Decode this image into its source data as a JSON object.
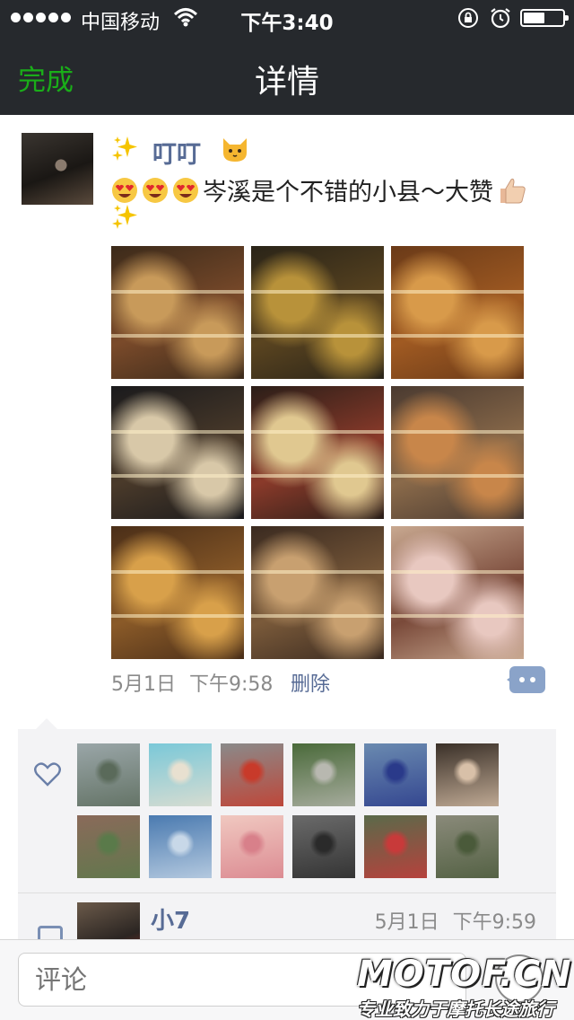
{
  "status_bar": {
    "carrier": "中国移动",
    "time": "下午3:40",
    "signal_dots": 5,
    "battery_level": 0.55,
    "icons": [
      "signal-dots-icon",
      "wifi-icon",
      "rotation-lock-icon",
      "alarm-icon",
      "battery-icon"
    ]
  },
  "nav": {
    "done_label": "完成",
    "title": "详情"
  },
  "post": {
    "author": "叮叮",
    "text": "岑溪是个不错的小县～大赞",
    "emoji_before_text": [
      "heart-eyes-emoji",
      "heart-eyes-emoji",
      "heart-eyes-emoji"
    ],
    "emoji_after_text": [
      "thumbs-up-emoji",
      "sparkles-emoji"
    ],
    "author_decorations": [
      "sparkles-emoji",
      "cat-emoji"
    ],
    "date": "5月1日",
    "time": "下午9:58",
    "delete_label": "删除",
    "photos": [
      {
        "name": "photo-cake-display-1",
        "colors": [
          "#3b2a1a",
          "#c89a5a",
          "#7a4a2a"
        ]
      },
      {
        "name": "photo-cake-display-2",
        "colors": [
          "#2a2418",
          "#b8923a",
          "#5a4420"
        ]
      },
      {
        "name": "photo-bread-shelves",
        "colors": [
          "#6a3a18",
          "#d89a4a",
          "#a05a22"
        ]
      },
      {
        "name": "photo-cake-slices-1",
        "colors": [
          "#1a1a1c",
          "#d8c8a8",
          "#4a3a2a"
        ]
      },
      {
        "name": "photo-cake-slices-2",
        "colors": [
          "#2a1e18",
          "#e0c890",
          "#8a3a2a"
        ]
      },
      {
        "name": "photo-bakery-counter",
        "colors": [
          "#4a3a30",
          "#c8864a",
          "#8a6a4a"
        ]
      },
      {
        "name": "photo-bread-rack",
        "colors": [
          "#4a2e18",
          "#d8a04a",
          "#8a5a28"
        ]
      },
      {
        "name": "photo-pastry-case",
        "colors": [
          "#3a2a20",
          "#c8a070",
          "#7a5a3a"
        ]
      },
      {
        "name": "photo-cafe-interior",
        "colors": [
          "#c8a890",
          "#e8c8c0",
          "#7a4a3a"
        ]
      }
    ]
  },
  "likes": {
    "icon": "heart-outline-icon",
    "avatars": [
      {
        "name": "like-avatar-1",
        "colors": [
          "#9aa6a8",
          "#5a6a5a"
        ]
      },
      {
        "name": "like-avatar-2",
        "colors": [
          "#7ac8d8",
          "#e8e0d0"
        ]
      },
      {
        "name": "like-avatar-3",
        "colors": [
          "#8a8a8a",
          "#c83a2a"
        ]
      },
      {
        "name": "like-avatar-4",
        "colors": [
          "#4a6a3a",
          "#b8b8b0"
        ]
      },
      {
        "name": "like-avatar-5",
        "colors": [
          "#6a8ab0",
          "#2a3a8a"
        ]
      },
      {
        "name": "like-avatar-6",
        "colors": [
          "#3a3028",
          "#d8c0a8"
        ]
      },
      {
        "name": "like-avatar-7",
        "colors": [
          "#8a6a5a",
          "#5a7a4a"
        ]
      },
      {
        "name": "like-avatar-8",
        "colors": [
          "#4a7ab0",
          "#c8d8e8"
        ]
      },
      {
        "name": "like-avatar-9",
        "colors": [
          "#f0c8c0",
          "#d8808a"
        ]
      },
      {
        "name": "like-avatar-10",
        "colors": [
          "#6a6a6a",
          "#2a2a2a"
        ]
      },
      {
        "name": "like-avatar-11",
        "colors": [
          "#5a6a4a",
          "#c83a3a"
        ]
      },
      {
        "name": "like-avatar-12",
        "colors": [
          "#8a8a7a",
          "#4a5a3a"
        ]
      }
    ]
  },
  "comment": {
    "icon": "comment-bubble-icon",
    "name": "小7",
    "date": "5月1日",
    "time": "下午9:59"
  },
  "input": {
    "placeholder": "评论",
    "emoji_button_icon": "smiley-icon"
  },
  "watermark": {
    "logo": "MOTOF.CN",
    "tagline": "专业致力于摩托长途旅行"
  },
  "colors": {
    "bar_background": "#26292d",
    "accent_green": "#1aad19",
    "link_blue": "#576b95",
    "panel_background": "#f3f3f5"
  }
}
